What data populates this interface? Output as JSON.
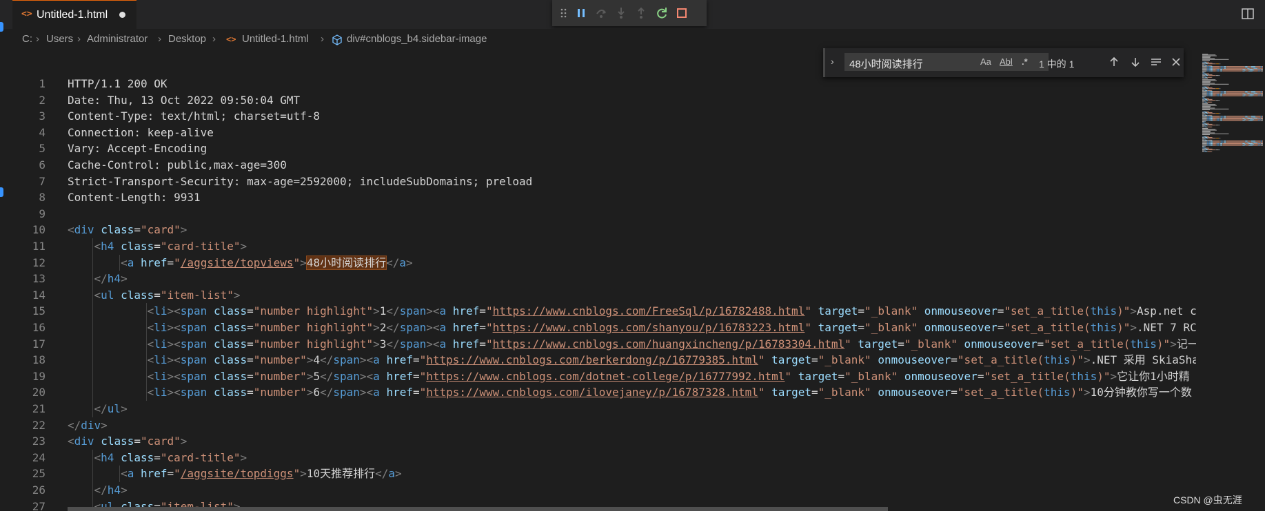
{
  "tab": {
    "icon": "<>",
    "label": "Untitled-1.html",
    "modified": true
  },
  "breadcrumb": [
    "C:",
    "Users",
    "Administrator",
    "Desktop",
    "Untitled-1.html",
    "div#cnblogs_b4.sidebar-image"
  ],
  "find": {
    "value": "48小时阅读排行",
    "match_case": "Aa",
    "whole_word": "Abl",
    "regex": ".*",
    "count": "1 中的 1"
  },
  "lines": [
    {
      "n": "1",
      "t": [
        [
          "x",
          "HTTP/1.1 200 OK"
        ]
      ]
    },
    {
      "n": "2",
      "t": [
        [
          "x",
          "Date: Thu, 13 Oct 2022 09:50:04 GMT"
        ]
      ]
    },
    {
      "n": "3",
      "t": [
        [
          "x",
          "Content-Type: text/html; charset=utf-8"
        ]
      ]
    },
    {
      "n": "4",
      "t": [
        [
          "x",
          "Connection: keep-alive"
        ]
      ]
    },
    {
      "n": "5",
      "t": [
        [
          "x",
          "Vary: Accept-Encoding"
        ]
      ]
    },
    {
      "n": "6",
      "t": [
        [
          "x",
          "Cache-Control: public,max-age=300"
        ]
      ]
    },
    {
      "n": "7",
      "t": [
        [
          "x",
          "Strict-Transport-Security: max-age=2592000; includeSubDomains; preload"
        ]
      ]
    },
    {
      "n": "8",
      "t": [
        [
          "x",
          "Content-Length: 9931"
        ]
      ]
    },
    {
      "n": "9",
      "t": []
    },
    {
      "n": "10",
      "t": [
        [
          "p",
          "<"
        ],
        [
          "t",
          "div"
        ],
        [
          "x",
          " "
        ],
        [
          "a",
          "class"
        ],
        [
          "x",
          "="
        ],
        [
          "s",
          "\"card\""
        ],
        [
          "p",
          ">"
        ]
      ]
    },
    {
      "n": "11",
      "t": [
        [
          "x",
          "    "
        ],
        [
          "p",
          "<"
        ],
        [
          "t",
          "h4"
        ],
        [
          "x",
          " "
        ],
        [
          "a",
          "class"
        ],
        [
          "x",
          "="
        ],
        [
          "s",
          "\"card-title\""
        ],
        [
          "p",
          ">"
        ]
      ]
    },
    {
      "n": "12",
      "t": [
        [
          "x",
          "        "
        ],
        [
          "p",
          "<"
        ],
        [
          "t",
          "a"
        ],
        [
          "x",
          " "
        ],
        [
          "a",
          "href"
        ],
        [
          "x",
          "="
        ],
        [
          "s",
          "\""
        ],
        [
          "su",
          "/aggsite/topviews"
        ],
        [
          "s",
          "\""
        ],
        [
          "p",
          ">"
        ],
        [
          "hl",
          "48小时阅读排行"
        ],
        [
          "p",
          "</"
        ],
        [
          "t",
          "a"
        ],
        [
          "p",
          ">"
        ]
      ]
    },
    {
      "n": "13",
      "t": [
        [
          "x",
          "    "
        ],
        [
          "p",
          "</"
        ],
        [
          "t",
          "h4"
        ],
        [
          "p",
          ">"
        ]
      ]
    },
    {
      "n": "14",
      "t": [
        [
          "x",
          "    "
        ],
        [
          "p",
          "<"
        ],
        [
          "t",
          "ul"
        ],
        [
          "x",
          " "
        ],
        [
          "a",
          "class"
        ],
        [
          "x",
          "="
        ],
        [
          "s",
          "\"item-list\""
        ],
        [
          "p",
          ">"
        ]
      ]
    },
    {
      "n": "15",
      "t": [
        [
          "x",
          "            "
        ],
        [
          "p",
          "<"
        ],
        [
          "t",
          "li"
        ],
        [
          "p",
          "><"
        ],
        [
          "t",
          "span"
        ],
        [
          "x",
          " "
        ],
        [
          "a",
          "class"
        ],
        [
          "x",
          "="
        ],
        [
          "s",
          "\"number highlight\""
        ],
        [
          "p",
          ">"
        ],
        [
          "x",
          "1"
        ],
        [
          "p",
          "</"
        ],
        [
          "t",
          "span"
        ],
        [
          "p",
          "><"
        ],
        [
          "t",
          "a"
        ],
        [
          "x",
          " "
        ],
        [
          "a",
          "href"
        ],
        [
          "x",
          "="
        ],
        [
          "s",
          "\""
        ],
        [
          "su",
          "https://www.cnblogs.com/FreeSql/p/16782488.html"
        ],
        [
          "s",
          "\""
        ],
        [
          "x",
          " "
        ],
        [
          "a",
          "target"
        ],
        [
          "x",
          "="
        ],
        [
          "s",
          "\"_blank\""
        ],
        [
          "x",
          " "
        ],
        [
          "a",
          "onmouseover"
        ],
        [
          "x",
          "="
        ],
        [
          "s",
          "\"set_a_title("
        ],
        [
          "t",
          "this"
        ],
        [
          "s",
          ")\""
        ],
        [
          "p",
          ">"
        ],
        [
          "x",
          "Asp.net co"
        ]
      ]
    },
    {
      "n": "16",
      "t": [
        [
          "x",
          "            "
        ],
        [
          "p",
          "<"
        ],
        [
          "t",
          "li"
        ],
        [
          "p",
          "><"
        ],
        [
          "t",
          "span"
        ],
        [
          "x",
          " "
        ],
        [
          "a",
          "class"
        ],
        [
          "x",
          "="
        ],
        [
          "s",
          "\"number highlight\""
        ],
        [
          "p",
          ">"
        ],
        [
          "x",
          "2"
        ],
        [
          "p",
          "</"
        ],
        [
          "t",
          "span"
        ],
        [
          "p",
          "><"
        ],
        [
          "t",
          "a"
        ],
        [
          "x",
          " "
        ],
        [
          "a",
          "href"
        ],
        [
          "x",
          "="
        ],
        [
          "s",
          "\""
        ],
        [
          "su",
          "https://www.cnblogs.com/shanyou/p/16783223.html"
        ],
        [
          "s",
          "\""
        ],
        [
          "x",
          " "
        ],
        [
          "a",
          "target"
        ],
        [
          "x",
          "="
        ],
        [
          "s",
          "\"_blank\""
        ],
        [
          "x",
          " "
        ],
        [
          "a",
          "onmouseover"
        ],
        [
          "x",
          "="
        ],
        [
          "s",
          "\"set_a_title("
        ],
        [
          "t",
          "this"
        ],
        [
          "s",
          ")\""
        ],
        [
          "p",
          ">"
        ],
        [
          "x",
          ".NET 7 RC"
        ]
      ]
    },
    {
      "n": "17",
      "t": [
        [
          "x",
          "            "
        ],
        [
          "p",
          "<"
        ],
        [
          "t",
          "li"
        ],
        [
          "p",
          "><"
        ],
        [
          "t",
          "span"
        ],
        [
          "x",
          " "
        ],
        [
          "a",
          "class"
        ],
        [
          "x",
          "="
        ],
        [
          "s",
          "\"number highlight\""
        ],
        [
          "p",
          ">"
        ],
        [
          "x",
          "3"
        ],
        [
          "p",
          "</"
        ],
        [
          "t",
          "span"
        ],
        [
          "p",
          "><"
        ],
        [
          "t",
          "a"
        ],
        [
          "x",
          " "
        ],
        [
          "a",
          "href"
        ],
        [
          "x",
          "="
        ],
        [
          "s",
          "\""
        ],
        [
          "su",
          "https://www.cnblogs.com/huangxincheng/p/16783304.html"
        ],
        [
          "s",
          "\""
        ],
        [
          "x",
          " "
        ],
        [
          "a",
          "target"
        ],
        [
          "x",
          "="
        ],
        [
          "s",
          "\"_blank\""
        ],
        [
          "x",
          " "
        ],
        [
          "a",
          "onmouseover"
        ],
        [
          "x",
          "="
        ],
        [
          "s",
          "\"set_a_title("
        ],
        [
          "t",
          "this"
        ],
        [
          "s",
          ")\""
        ],
        [
          "p",
          ">"
        ],
        [
          "x",
          "记一"
        ]
      ]
    },
    {
      "n": "18",
      "t": [
        [
          "x",
          "            "
        ],
        [
          "p",
          "<"
        ],
        [
          "t",
          "li"
        ],
        [
          "p",
          "><"
        ],
        [
          "t",
          "span"
        ],
        [
          "x",
          " "
        ],
        [
          "a",
          "class"
        ],
        [
          "x",
          "="
        ],
        [
          "s",
          "\"number\""
        ],
        [
          "p",
          ">"
        ],
        [
          "x",
          "4"
        ],
        [
          "p",
          "</"
        ],
        [
          "t",
          "span"
        ],
        [
          "p",
          "><"
        ],
        [
          "t",
          "a"
        ],
        [
          "x",
          " "
        ],
        [
          "a",
          "href"
        ],
        [
          "x",
          "="
        ],
        [
          "s",
          "\""
        ],
        [
          "su",
          "https://www.cnblogs.com/berkerdong/p/16779385.html"
        ],
        [
          "s",
          "\""
        ],
        [
          "x",
          " "
        ],
        [
          "a",
          "target"
        ],
        [
          "x",
          "="
        ],
        [
          "s",
          "\"_blank\""
        ],
        [
          "x",
          " "
        ],
        [
          "a",
          "onmouseover"
        ],
        [
          "x",
          "="
        ],
        [
          "s",
          "\"set_a_title("
        ],
        [
          "t",
          "this"
        ],
        [
          "s",
          ")\""
        ],
        [
          "p",
          ">"
        ],
        [
          "x",
          ".NET 采用 SkiaSha"
        ]
      ]
    },
    {
      "n": "19",
      "t": [
        [
          "x",
          "            "
        ],
        [
          "p",
          "<"
        ],
        [
          "t",
          "li"
        ],
        [
          "p",
          "><"
        ],
        [
          "t",
          "span"
        ],
        [
          "x",
          " "
        ],
        [
          "a",
          "class"
        ],
        [
          "x",
          "="
        ],
        [
          "s",
          "\"number\""
        ],
        [
          "p",
          ">"
        ],
        [
          "x",
          "5"
        ],
        [
          "p",
          "</"
        ],
        [
          "t",
          "span"
        ],
        [
          "p",
          "><"
        ],
        [
          "t",
          "a"
        ],
        [
          "x",
          " "
        ],
        [
          "a",
          "href"
        ],
        [
          "x",
          "="
        ],
        [
          "s",
          "\""
        ],
        [
          "su",
          "https://www.cnblogs.com/dotnet-college/p/16777992.html"
        ],
        [
          "s",
          "\""
        ],
        [
          "x",
          " "
        ],
        [
          "a",
          "target"
        ],
        [
          "x",
          "="
        ],
        [
          "s",
          "\"_blank\""
        ],
        [
          "x",
          " "
        ],
        [
          "a",
          "onmouseover"
        ],
        [
          "x",
          "="
        ],
        [
          "s",
          "\"set_a_title("
        ],
        [
          "t",
          "this"
        ],
        [
          "s",
          ")\""
        ],
        [
          "p",
          ">"
        ],
        [
          "x",
          "它让你1小时精"
        ]
      ]
    },
    {
      "n": "20",
      "t": [
        [
          "x",
          "            "
        ],
        [
          "p",
          "<"
        ],
        [
          "t",
          "li"
        ],
        [
          "p",
          "><"
        ],
        [
          "t",
          "span"
        ],
        [
          "x",
          " "
        ],
        [
          "a",
          "class"
        ],
        [
          "x",
          "="
        ],
        [
          "s",
          "\"number\""
        ],
        [
          "p",
          ">"
        ],
        [
          "x",
          "6"
        ],
        [
          "p",
          "</"
        ],
        [
          "t",
          "span"
        ],
        [
          "p",
          "><"
        ],
        [
          "t",
          "a"
        ],
        [
          "x",
          " "
        ],
        [
          "a",
          "href"
        ],
        [
          "x",
          "="
        ],
        [
          "s",
          "\""
        ],
        [
          "su",
          "https://www.cnblogs.com/ilovejaney/p/16787328.html"
        ],
        [
          "s",
          "\""
        ],
        [
          "x",
          " "
        ],
        [
          "a",
          "target"
        ],
        [
          "x",
          "="
        ],
        [
          "s",
          "\"_blank\""
        ],
        [
          "x",
          " "
        ],
        [
          "a",
          "onmouseover"
        ],
        [
          "x",
          "="
        ],
        [
          "s",
          "\"set_a_title("
        ],
        [
          "t",
          "this"
        ],
        [
          "s",
          ")\""
        ],
        [
          "p",
          ">"
        ],
        [
          "x",
          "10分钟教你写一个数"
        ]
      ]
    },
    {
      "n": "21",
      "t": [
        [
          "x",
          "    "
        ],
        [
          "p",
          "</"
        ],
        [
          "t",
          "ul"
        ],
        [
          "p",
          ">"
        ]
      ]
    },
    {
      "n": "22",
      "t": [
        [
          "p",
          "</"
        ],
        [
          "t",
          "div"
        ],
        [
          "p",
          ">"
        ]
      ]
    },
    {
      "n": "23",
      "t": [
        [
          "p",
          "<"
        ],
        [
          "t",
          "div"
        ],
        [
          "x",
          " "
        ],
        [
          "a",
          "class"
        ],
        [
          "x",
          "="
        ],
        [
          "s",
          "\"card\""
        ],
        [
          "p",
          ">"
        ]
      ]
    },
    {
      "n": "24",
      "t": [
        [
          "x",
          "    "
        ],
        [
          "p",
          "<"
        ],
        [
          "t",
          "h4"
        ],
        [
          "x",
          " "
        ],
        [
          "a",
          "class"
        ],
        [
          "x",
          "="
        ],
        [
          "s",
          "\"card-title\""
        ],
        [
          "p",
          ">"
        ]
      ]
    },
    {
      "n": "25",
      "t": [
        [
          "x",
          "        "
        ],
        [
          "p",
          "<"
        ],
        [
          "t",
          "a"
        ],
        [
          "x",
          " "
        ],
        [
          "a",
          "href"
        ],
        [
          "x",
          "="
        ],
        [
          "s",
          "\""
        ],
        [
          "su",
          "/aggsite/topdiggs"
        ],
        [
          "s",
          "\""
        ],
        [
          "p",
          ">"
        ],
        [
          "x",
          "10天推荐排行"
        ],
        [
          "p",
          "</"
        ],
        [
          "t",
          "a"
        ],
        [
          "p",
          ">"
        ]
      ]
    },
    {
      "n": "26",
      "t": [
        [
          "x",
          "    "
        ],
        [
          "p",
          "</"
        ],
        [
          "t",
          "h4"
        ],
        [
          "p",
          ">"
        ]
      ]
    },
    {
      "n": "27",
      "t": [
        [
          "x",
          "    "
        ],
        [
          "p",
          "<"
        ],
        [
          "t",
          "ul"
        ],
        [
          "x",
          " "
        ],
        [
          "a",
          "class"
        ],
        [
          "x",
          "="
        ],
        [
          "s",
          "\"item-list\""
        ],
        [
          "p",
          ">"
        ]
      ]
    }
  ],
  "colors": {
    "keyword_tag": "#569cd6",
    "attribute": "#9cdcfe",
    "string": "#ce9178",
    "punctuation": "#808080",
    "text": "#d4d4d4",
    "find_highlight": "#613214",
    "modified_tab_accent": "#e8650a"
  },
  "watermark": "CSDN @虫无涯"
}
